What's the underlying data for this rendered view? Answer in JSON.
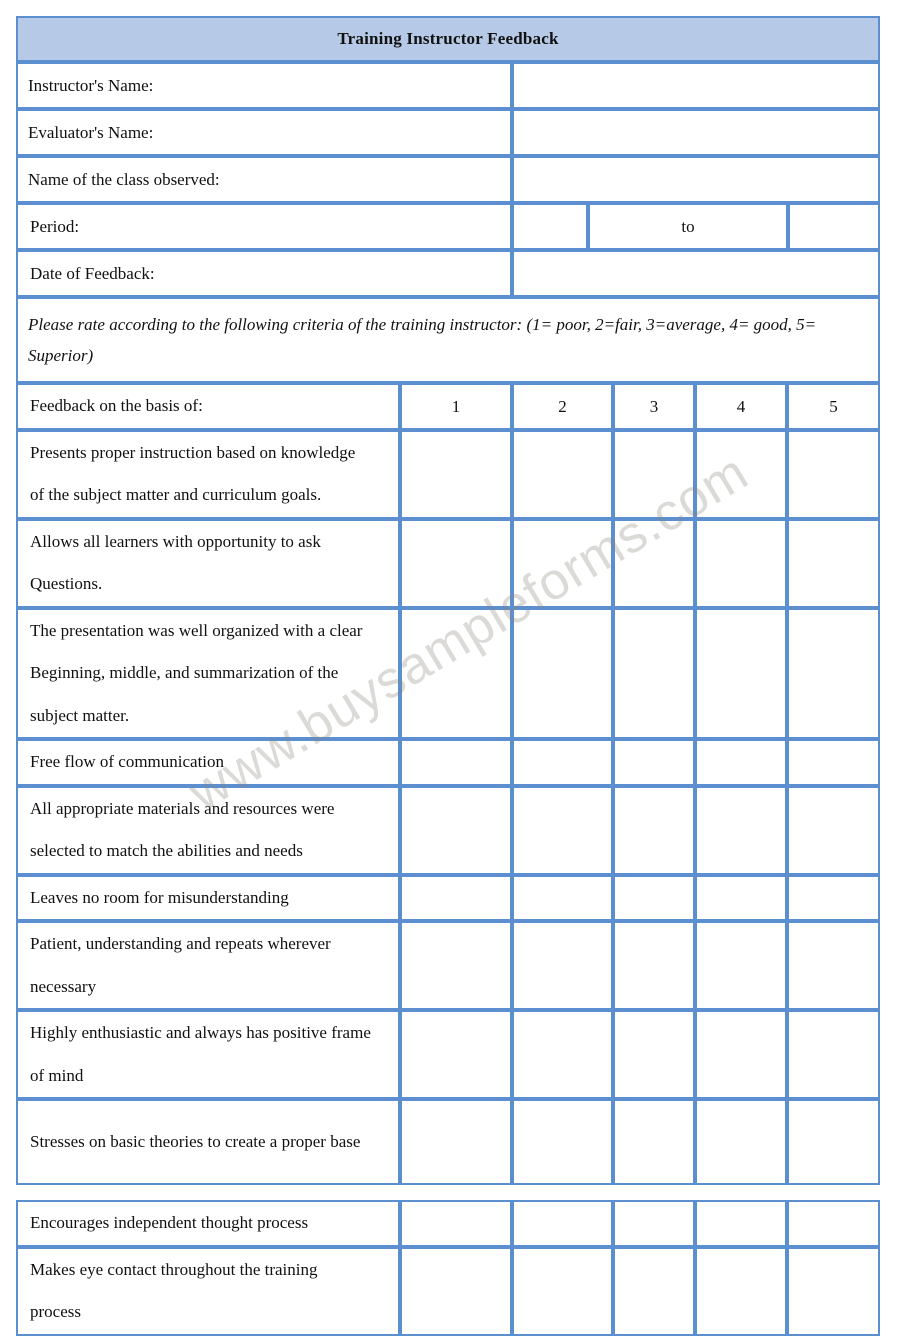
{
  "document": {
    "title": "Training Instructor Feedback",
    "watermark": "www.buysampleforms.com"
  },
  "colors": {
    "border": "#5b8fd0",
    "title_fill": "#b6c9e6",
    "row_fill": "#dae2ef",
    "blank_fill": "#ffffff"
  },
  "info_fields": [
    {
      "label": "Instructor's Name:",
      "value": ""
    },
    {
      "label": "Evaluator's Name:",
      "value": ""
    },
    {
      "label": "Name of the class observed:",
      "value": ""
    },
    {
      "label": "Period:",
      "value": "",
      "separator": "to",
      "value_end": ""
    },
    {
      "label": "Date of Feedback:",
      "value": ""
    }
  ],
  "instruction": "Please rate according to the following criteria of the training instructor: (1= poor, 2=fair, 3=average, 4= good, 5= Superior)",
  "rating_table": {
    "criteria_header": "Feedback on the basis of:",
    "scale": [
      "1",
      "2",
      "3",
      "4",
      "5"
    ],
    "criteria": [
      {
        "lines": [
          "Presents proper instruction based on knowledge",
          "of the subject matter and curriculum goals."
        ]
      },
      {
        "lines": [
          "Allows all learners with opportunity to ask",
          "Questions."
        ]
      },
      {
        "lines": [
          "The presentation was well organized with a clear",
          "Beginning, middle, and summarization of the",
          "subject matter."
        ]
      },
      {
        "lines": [
          "Free flow of communication"
        ]
      },
      {
        "lines": [
          "All appropriate materials and resources were",
          "selected to match the abilities and needs"
        ]
      },
      {
        "lines": [
          "Leaves no room for misunderstanding"
        ]
      },
      {
        "lines": [
          "Patient, understanding and repeats wherever",
          "necessary"
        ]
      },
      {
        "lines": [
          "Highly enthusiastic and always has positive frame",
          "of mind"
        ]
      },
      {
        "lines": [
          "Stresses on basic theories to create a proper base"
        ]
      }
    ],
    "criteria_continued": [
      {
        "lines": [
          "Encourages independent thought process"
        ]
      },
      {
        "lines": [
          "Makes eye contact throughout the training",
          "process"
        ]
      }
    ]
  }
}
